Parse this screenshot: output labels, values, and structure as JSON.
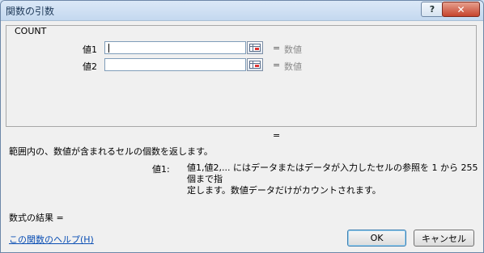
{
  "window": {
    "title": "関数の引数",
    "help_glyph": "?",
    "close_glyph": "✕"
  },
  "function_group": {
    "name": "COUNT",
    "args": [
      {
        "label": "値1",
        "value": "",
        "eq": "=",
        "result": "数値"
      },
      {
        "label": "値2",
        "value": "",
        "eq": "=",
        "result": "数値"
      }
    ],
    "result_eq": "="
  },
  "description": "範囲内の、数値が含まれるセルの個数を返します。",
  "arg_help": {
    "name": "値1:",
    "line1": "値1,値2,... にはデータまたはデータが入力したセルの参照を 1 から 255 個まで指",
    "line2": "定します。数値データだけがカウントされます。"
  },
  "formula_result": "数式の結果 =",
  "help_link": "この関数のヘルプ(H)",
  "buttons": {
    "ok": "OK",
    "cancel": "キャンセル"
  },
  "icons": {
    "ref_button": "range-select-icon"
  }
}
